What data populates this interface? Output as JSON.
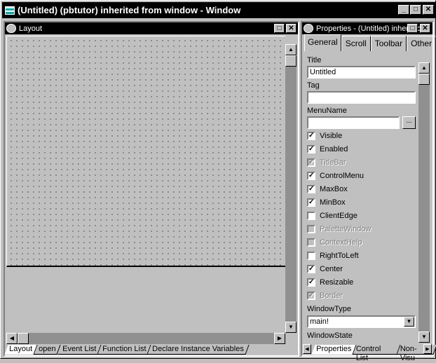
{
  "window": {
    "title": "(Untitled) (pbtutor) inherited from window - Window",
    "min": "_",
    "max": "□",
    "close": "✕"
  },
  "layout": {
    "title": "Layout",
    "max": "□",
    "close": "✕"
  },
  "bottom_tabs": [
    "Layout",
    "open",
    "Event List",
    "Function List",
    "Declare Instance Variables"
  ],
  "properties": {
    "title": "Properties - (Untitled) inherited",
    "max": "□",
    "close": "✕",
    "tabs": [
      "General",
      "Scroll",
      "Toolbar",
      "Other"
    ],
    "title_label": "Title",
    "title_value": "Untitled",
    "tag_label": "Tag",
    "tag_value": "",
    "menuname_label": "MenuName",
    "menuname_value": "",
    "browse": "...",
    "checkboxes": [
      {
        "label": "Visible",
        "checked": true,
        "disabled": false
      },
      {
        "label": "Enabled",
        "checked": true,
        "disabled": false
      },
      {
        "label": "TitleBar",
        "checked": true,
        "disabled": true
      },
      {
        "label": "ControlMenu",
        "checked": true,
        "disabled": false
      },
      {
        "label": "MaxBox",
        "checked": true,
        "disabled": false
      },
      {
        "label": "MinBox",
        "checked": true,
        "disabled": false
      },
      {
        "label": "ClientEdge",
        "checked": false,
        "disabled": false
      },
      {
        "label": "PaletteWindow",
        "checked": false,
        "disabled": true
      },
      {
        "label": "ContextHelp",
        "checked": false,
        "disabled": true
      },
      {
        "label": "RightToLeft",
        "checked": false,
        "disabled": false
      },
      {
        "label": "Center",
        "checked": true,
        "disabled": false
      },
      {
        "label": "Resizable",
        "checked": true,
        "disabled": false
      },
      {
        "label": "Border",
        "checked": true,
        "disabled": true
      }
    ],
    "windowtype_label": "WindowType",
    "windowtype_value": "main!",
    "windowstate_label": "WindowState",
    "bottom_tabs": [
      "Properties",
      "Control List",
      "Non-Visu"
    ]
  }
}
